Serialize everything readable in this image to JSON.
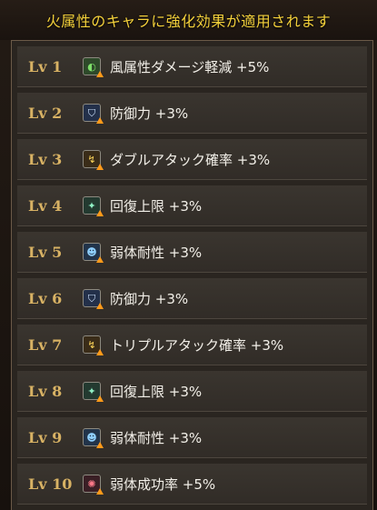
{
  "banner": {
    "text": "火属性のキャラに強化効果が適用されます"
  },
  "levels": [
    {
      "level": "Lv 1",
      "effect": "風属性ダメージ軽減 +5%",
      "icon": "wind-resist-icon"
    },
    {
      "level": "Lv 2",
      "effect": "防御力 +3%",
      "icon": "defense-shield-icon"
    },
    {
      "level": "Lv 3",
      "effect": "ダブルアタック確率 +3%",
      "icon": "double-attack-icon"
    },
    {
      "level": "Lv 4",
      "effect": "回復上限 +3%",
      "icon": "heal-cap-icon"
    },
    {
      "level": "Lv 5",
      "effect": "弱体耐性 +3%",
      "icon": "debuff-resist-icon"
    },
    {
      "level": "Lv 6",
      "effect": "防御力 +3%",
      "icon": "defense-shield-icon"
    },
    {
      "level": "Lv 7",
      "effect": "トリプルアタック確率 +3%",
      "icon": "triple-attack-icon"
    },
    {
      "level": "Lv 8",
      "effect": "回復上限 +3%",
      "icon": "heal-cap-icon"
    },
    {
      "level": "Lv 9",
      "effect": "弱体耐性 +3%",
      "icon": "debuff-resist-icon"
    },
    {
      "level": "Lv 10",
      "effect": "弱体成功率 +5%",
      "icon": "debuff-success-icon"
    }
  ],
  "colors": {
    "banner_text": "#f4d13b",
    "level_text": "#d8b264",
    "effect_text": "#f2efe8",
    "boost_arrow": "#ff9a1a"
  }
}
